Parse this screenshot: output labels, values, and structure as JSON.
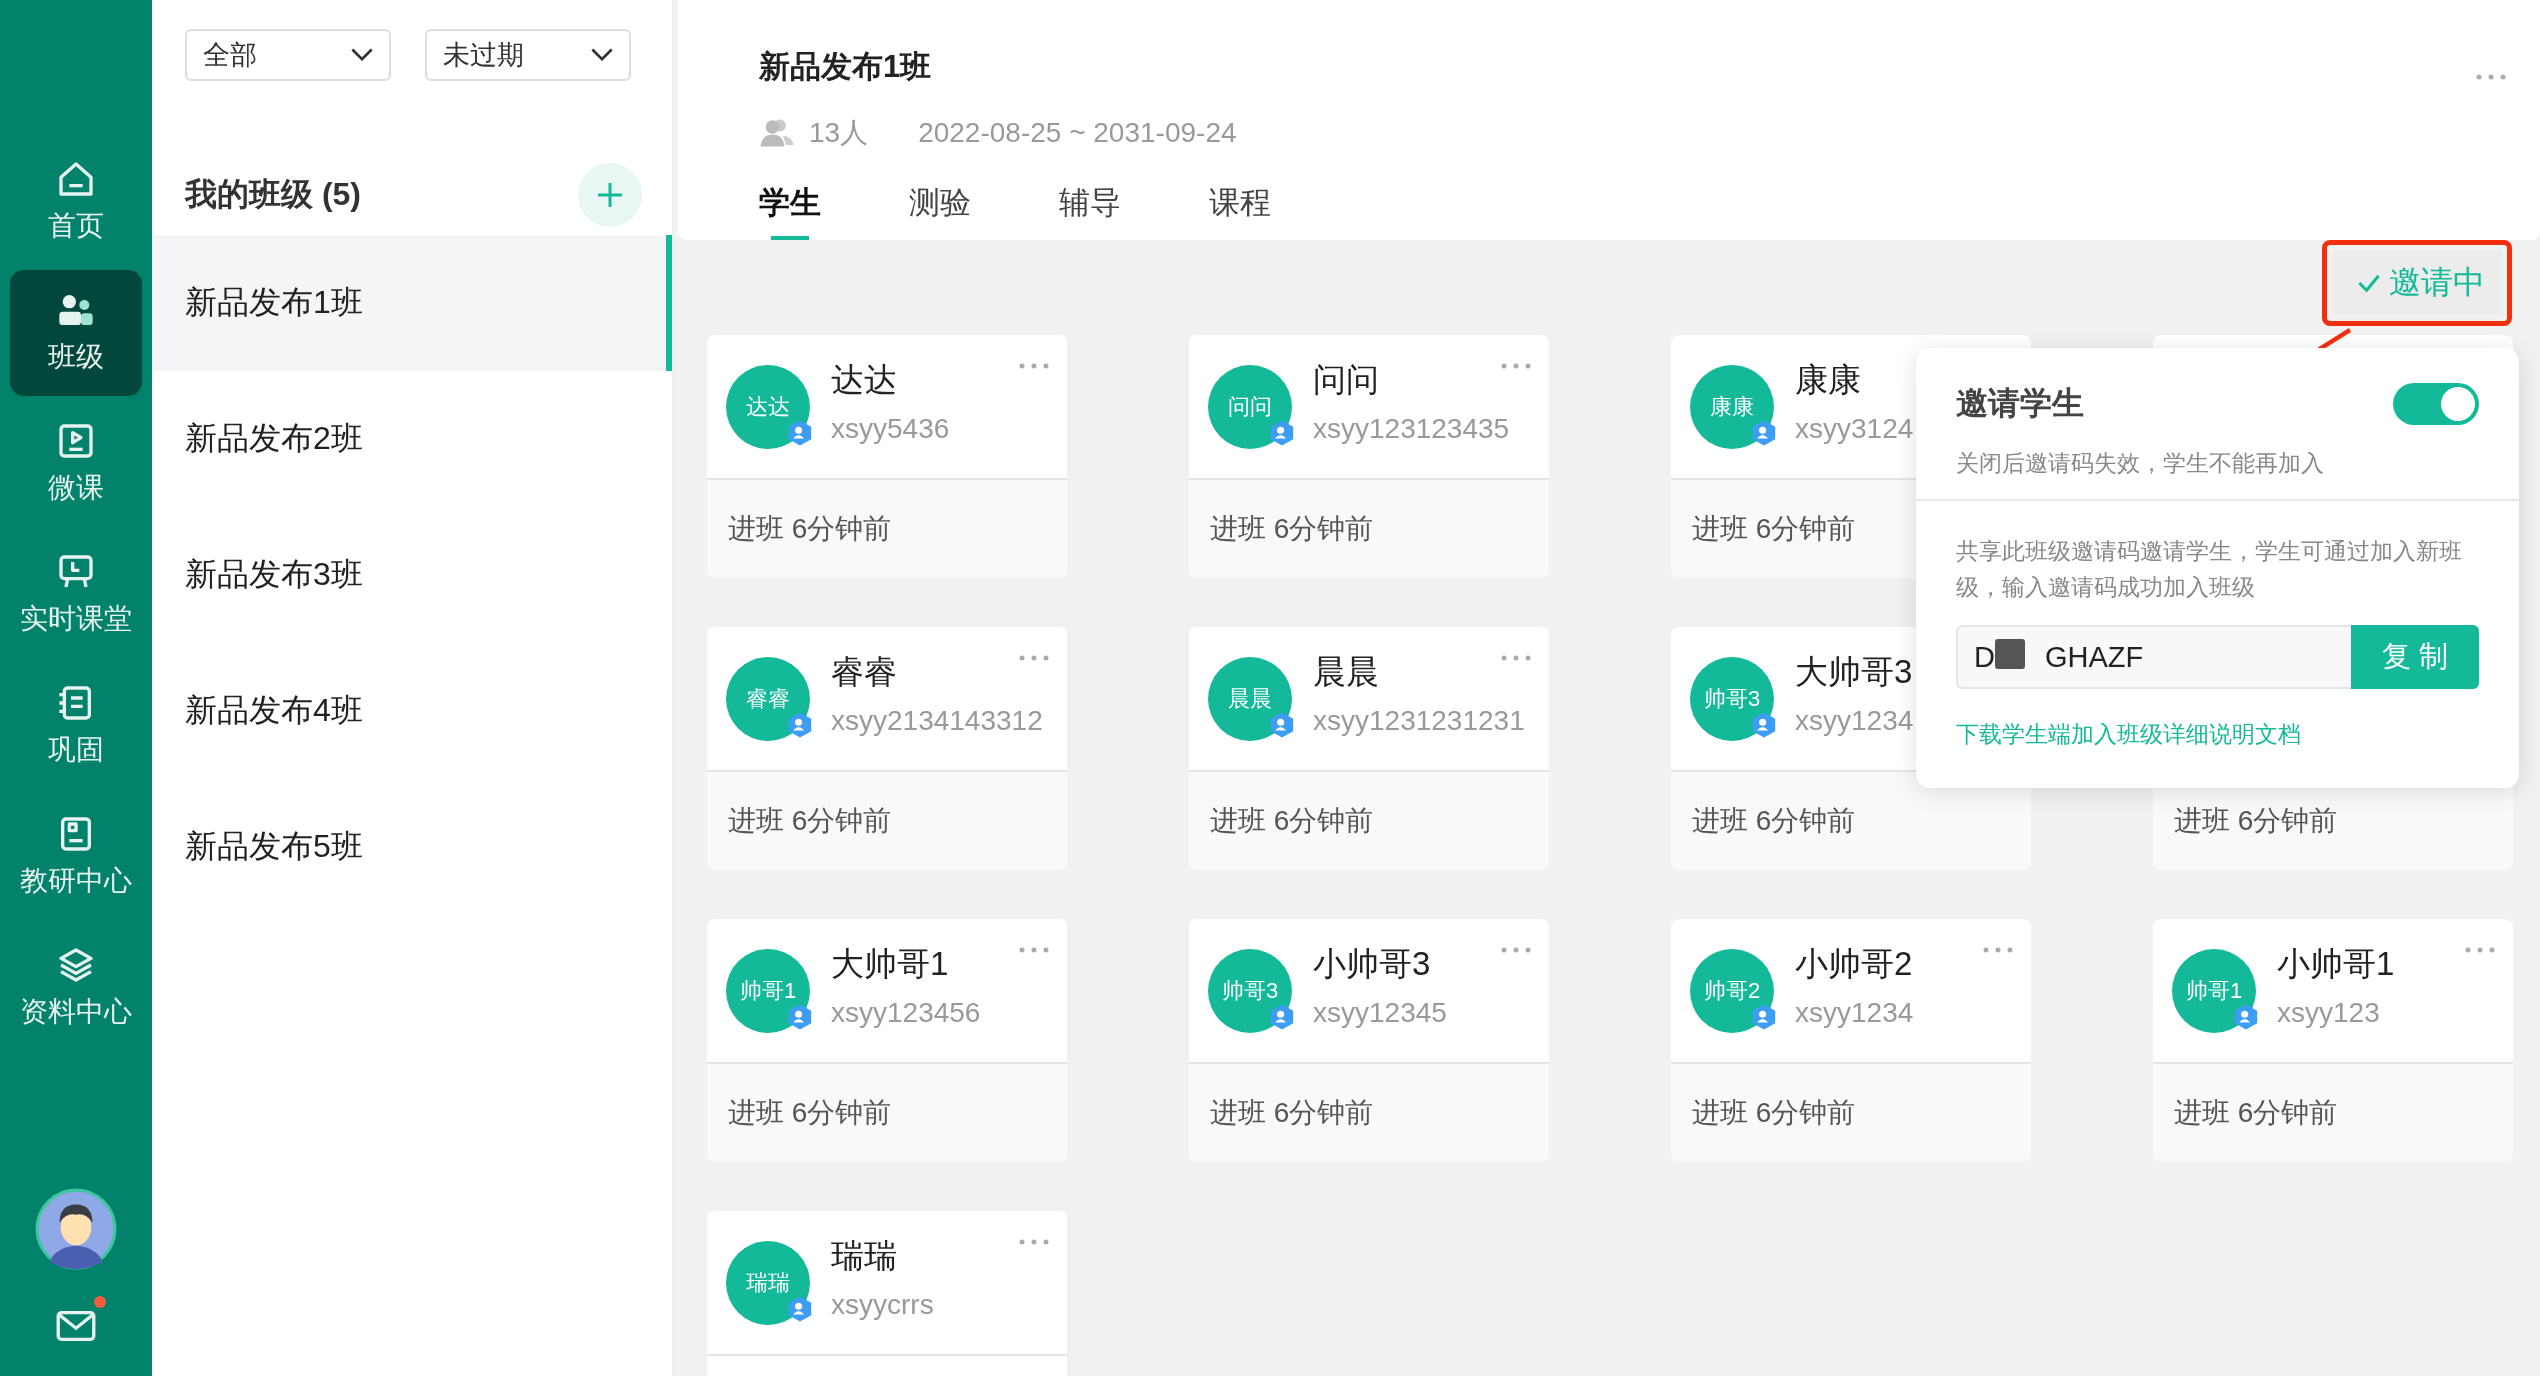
{
  "nav": {
    "items": [
      {
        "label": "首页",
        "selected": false
      },
      {
        "label": "班级",
        "selected": true
      },
      {
        "label": "微课",
        "selected": false
      },
      {
        "label": "实时课堂",
        "selected": false
      },
      {
        "label": "巩固",
        "selected": false
      },
      {
        "label": "教研中心",
        "selected": false
      },
      {
        "label": "资料中心",
        "selected": false
      }
    ],
    "mail_unread": true
  },
  "filters": [
    {
      "value": "全部"
    },
    {
      "value": "未过期"
    }
  ],
  "class_list": {
    "title": "我的班级 (5)",
    "items": [
      {
        "label": "新品发布1班",
        "selected": true
      },
      {
        "label": "新品发布2班",
        "selected": false
      },
      {
        "label": "新品发布3班",
        "selected": false
      },
      {
        "label": "新品发布4班",
        "selected": false
      },
      {
        "label": "新品发布5班",
        "selected": false
      }
    ]
  },
  "header": {
    "title": "新品发布1班",
    "members": "13人",
    "period": "2022-08-25 ~ 2031-09-24",
    "tabs": [
      {
        "label": "学生",
        "selected": true
      },
      {
        "label": "测验",
        "selected": false
      },
      {
        "label": "辅导",
        "selected": false
      },
      {
        "label": "课程",
        "selected": false
      }
    ]
  },
  "invite_button": {
    "label": "邀请中",
    "checked": true
  },
  "students": [
    {
      "avatar_text": "达达",
      "name": "达达",
      "account": "xsyy5436",
      "joined": "进班 6分钟前"
    },
    {
      "avatar_text": "问问",
      "name": "问问",
      "account": "xsyy123123435",
      "joined": "进班 6分钟前"
    },
    {
      "avatar_text": "康康",
      "name": "康康",
      "account": "xsyy3124",
      "joined": "进班 6分钟前"
    },
    {
      "avatar_text": "睿睿",
      "name": "睿睿",
      "account": "xsyy2134143312",
      "joined": "进班 6分钟前"
    },
    {
      "avatar_text": "晨晨",
      "name": "晨晨",
      "account": "xsyy1231231231",
      "joined": "进班 6分钟前"
    },
    {
      "avatar_text": "帅哥3",
      "name": "大帅哥3",
      "account": "xsyy1234",
      "joined": "进班 6分钟前"
    },
    {
      "joined": "进班 6分钟前"
    },
    {
      "avatar_text": "帅哥1",
      "name": "大帅哥1",
      "account": "xsyy123456",
      "joined": "进班 6分钟前"
    },
    {
      "avatar_text": "帅哥3",
      "name": "小帅哥3",
      "account": "xsyy12345",
      "joined": "进班 6分钟前"
    },
    {
      "avatar_text": "帅哥2",
      "name": "小帅哥2",
      "account": "xsyy1234",
      "joined": "进班 6分钟前"
    },
    {
      "avatar_text": "帅哥1",
      "name": "小帅哥1",
      "account": "xsyy123",
      "joined": "进班 6分钟前"
    },
    {
      "avatar_text": "瑞瑞",
      "name": "瑞瑞",
      "account": "xsyycrrs"
    }
  ],
  "invite_popup": {
    "title": "邀请学生",
    "enabled": true,
    "note": "关闭后邀请码失效，学生不能再加入",
    "description": "共享此班级邀请码邀请学生，学生可通过加入新班级，输入邀请码成功加入班级",
    "code_start": "D",
    "code_end": "GHAZF",
    "copy_button": "复 制",
    "link": "下载学生端加入班级详细说明文档"
  }
}
